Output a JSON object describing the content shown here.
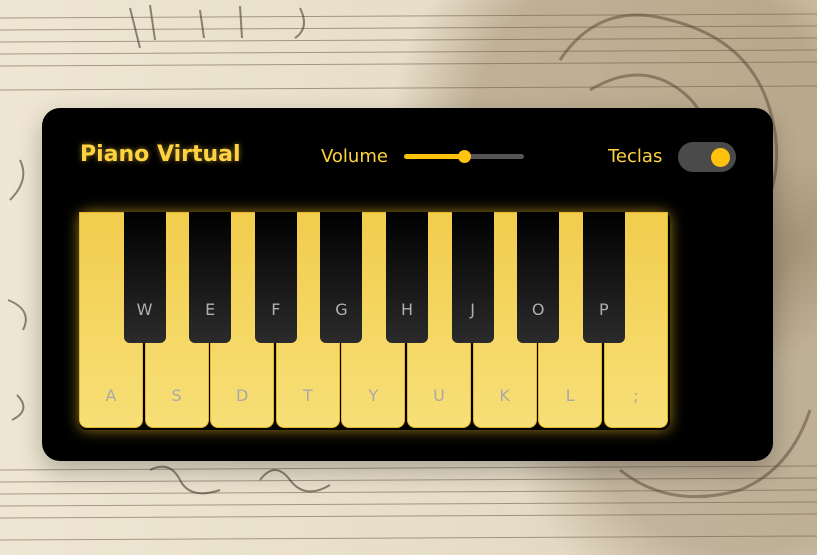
{
  "header": {
    "title": "Piano Virtual",
    "volume_label": "Volume",
    "keys_label": "Teclas"
  },
  "volume": {
    "value": 0.5
  },
  "toggle": {
    "on": true
  },
  "piano": {
    "white_keys": [
      "A",
      "S",
      "D",
      "T",
      "Y",
      "U",
      "K",
      "L",
      ";"
    ],
    "black_keys": [
      "W",
      "E",
      "F",
      "G",
      "H",
      "J",
      "O",
      "P"
    ]
  },
  "colors": {
    "accent": "#ffc20e",
    "title": "#ffd23f",
    "panel": "#000000"
  }
}
